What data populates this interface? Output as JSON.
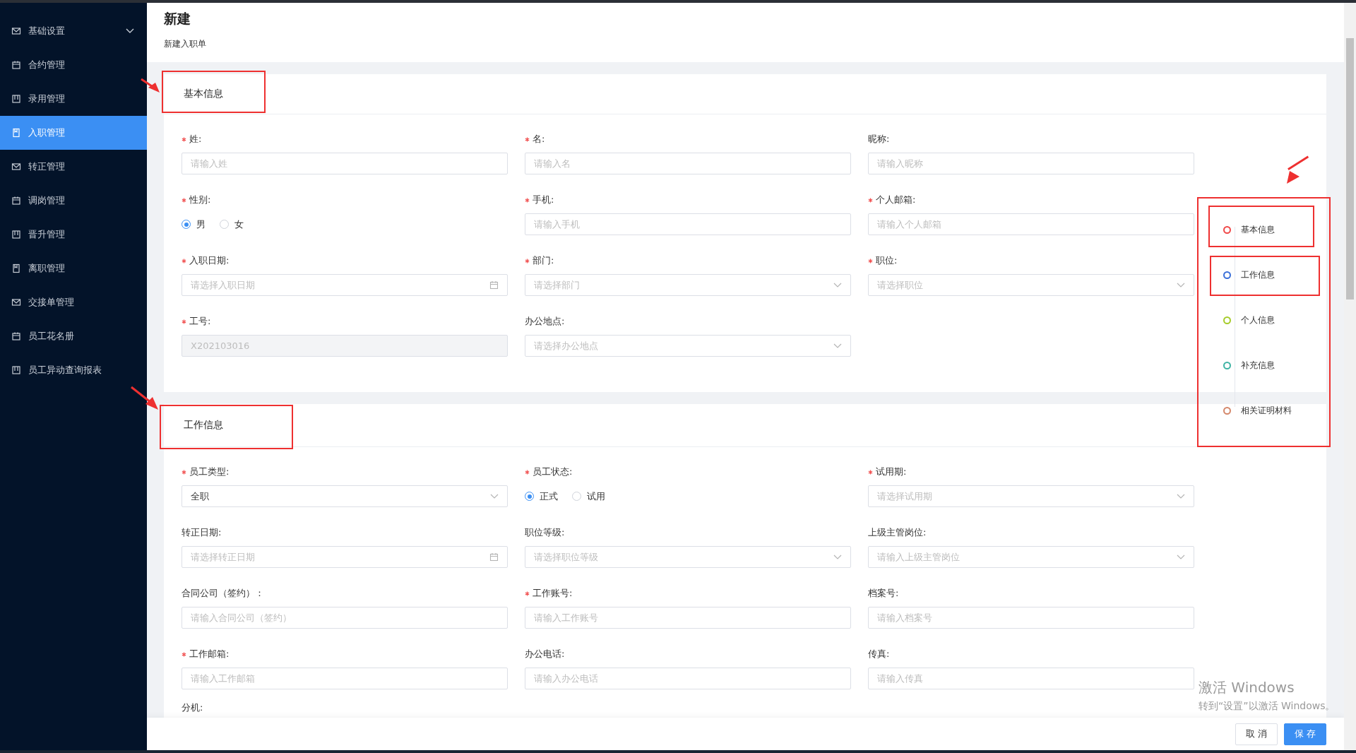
{
  "sidebar": {
    "items": [
      {
        "label": "基础设置",
        "selected": false,
        "expanded": false
      },
      {
        "label": "合约管理",
        "selected": false
      },
      {
        "label": "录用管理",
        "selected": false
      },
      {
        "label": "入职管理",
        "selected": true
      },
      {
        "label": "转正管理",
        "selected": false
      },
      {
        "label": "调岗管理",
        "selected": false
      },
      {
        "label": "晋升管理",
        "selected": false
      },
      {
        "label": "离职管理",
        "selected": false
      },
      {
        "label": "交接单管理",
        "selected": false
      },
      {
        "label": "员工花名册",
        "selected": false
      },
      {
        "label": "员工异动查询报表",
        "selected": false
      }
    ]
  },
  "header": {
    "title": "新建",
    "subtitle": "新建入职单"
  },
  "sections": [
    {
      "title": "基本信息",
      "fields": [
        {
          "label": "姓:",
          "required": true,
          "kind": "input",
          "placeholder": "请输入姓"
        },
        {
          "label": "名:",
          "required": true,
          "kind": "input",
          "placeholder": "请输入名"
        },
        {
          "label": "昵称:",
          "required": false,
          "kind": "input",
          "placeholder": "请输入昵称"
        },
        {
          "label": "性别:",
          "required": true,
          "kind": "radio",
          "options": [
            {
              "label": "男",
              "selected": true
            },
            {
              "label": "女",
              "selected": false
            }
          ]
        },
        {
          "label": "手机:",
          "required": true,
          "kind": "input",
          "placeholder": "请输入手机"
        },
        {
          "label": "个人邮箱:",
          "required": true,
          "kind": "input",
          "placeholder": "请输入个人邮箱"
        },
        {
          "label": "入职日期:",
          "required": true,
          "kind": "date",
          "placeholder": "请选择入职日期"
        },
        {
          "label": "部门:",
          "required": true,
          "kind": "select",
          "placeholder": "请选择部门"
        },
        {
          "label": "职位:",
          "required": true,
          "kind": "select",
          "placeholder": "请选择职位"
        },
        {
          "label": "工号:",
          "required": true,
          "kind": "input",
          "value": "X202103016",
          "disabled": true
        },
        {
          "label": "办公地点:",
          "required": false,
          "kind": "select",
          "placeholder": "请选择办公地点"
        }
      ]
    },
    {
      "title": "工作信息",
      "fields": [
        {
          "label": "员工类型:",
          "required": true,
          "kind": "select",
          "value": "全职"
        },
        {
          "label": "员工状态:",
          "required": true,
          "kind": "radio",
          "options": [
            {
              "label": "正式",
              "selected": true
            },
            {
              "label": "试用",
              "selected": false
            }
          ]
        },
        {
          "label": "试用期:",
          "required": true,
          "kind": "select",
          "placeholder": "请选择试用期"
        },
        {
          "label": "转正日期:",
          "required": false,
          "kind": "date",
          "placeholder": "请选择转正日期"
        },
        {
          "label": "职位等级:",
          "required": false,
          "kind": "select",
          "placeholder": "请选择职位等级"
        },
        {
          "label": "上级主管岗位:",
          "required": false,
          "kind": "select",
          "placeholder": "请输入上级主管岗位"
        },
        {
          "label": "合同公司（签约）：",
          "required": false,
          "kind": "input",
          "placeholder": "请输入合同公司（签约）"
        },
        {
          "label": "工作账号:",
          "required": true,
          "kind": "input",
          "placeholder": "请输入工作账号"
        },
        {
          "label": "档案号:",
          "required": false,
          "kind": "input",
          "placeholder": "请输入档案号"
        },
        {
          "label": "工作邮箱:",
          "required": true,
          "kind": "input",
          "placeholder": "请输入工作邮箱"
        },
        {
          "label": "办公电话:",
          "required": false,
          "kind": "input",
          "placeholder": "请输入办公电话"
        },
        {
          "label": "传真:",
          "required": false,
          "kind": "input",
          "placeholder": "请输入传真"
        },
        {
          "label": "分机:",
          "required": false,
          "kind": "cut"
        }
      ]
    }
  ],
  "anchor_nav": [
    {
      "label": "基本信息",
      "color": "#f04848"
    },
    {
      "label": "工作信息",
      "color": "#3a6fd8"
    },
    {
      "label": "个人信息",
      "color": "#a6cc2a"
    },
    {
      "label": "补充信息",
      "color": "#3fb3a4"
    },
    {
      "label": "相关证明材料",
      "color": "#d4876a"
    }
  ],
  "footer": {
    "buttons": [
      {
        "label": "取 消",
        "kind": "secondary"
      },
      {
        "label": "保 存",
        "kind": "primary"
      }
    ]
  },
  "os_notice": {
    "title": "激活 Windows",
    "text": "转到“设置”以激活 Windows。"
  }
}
